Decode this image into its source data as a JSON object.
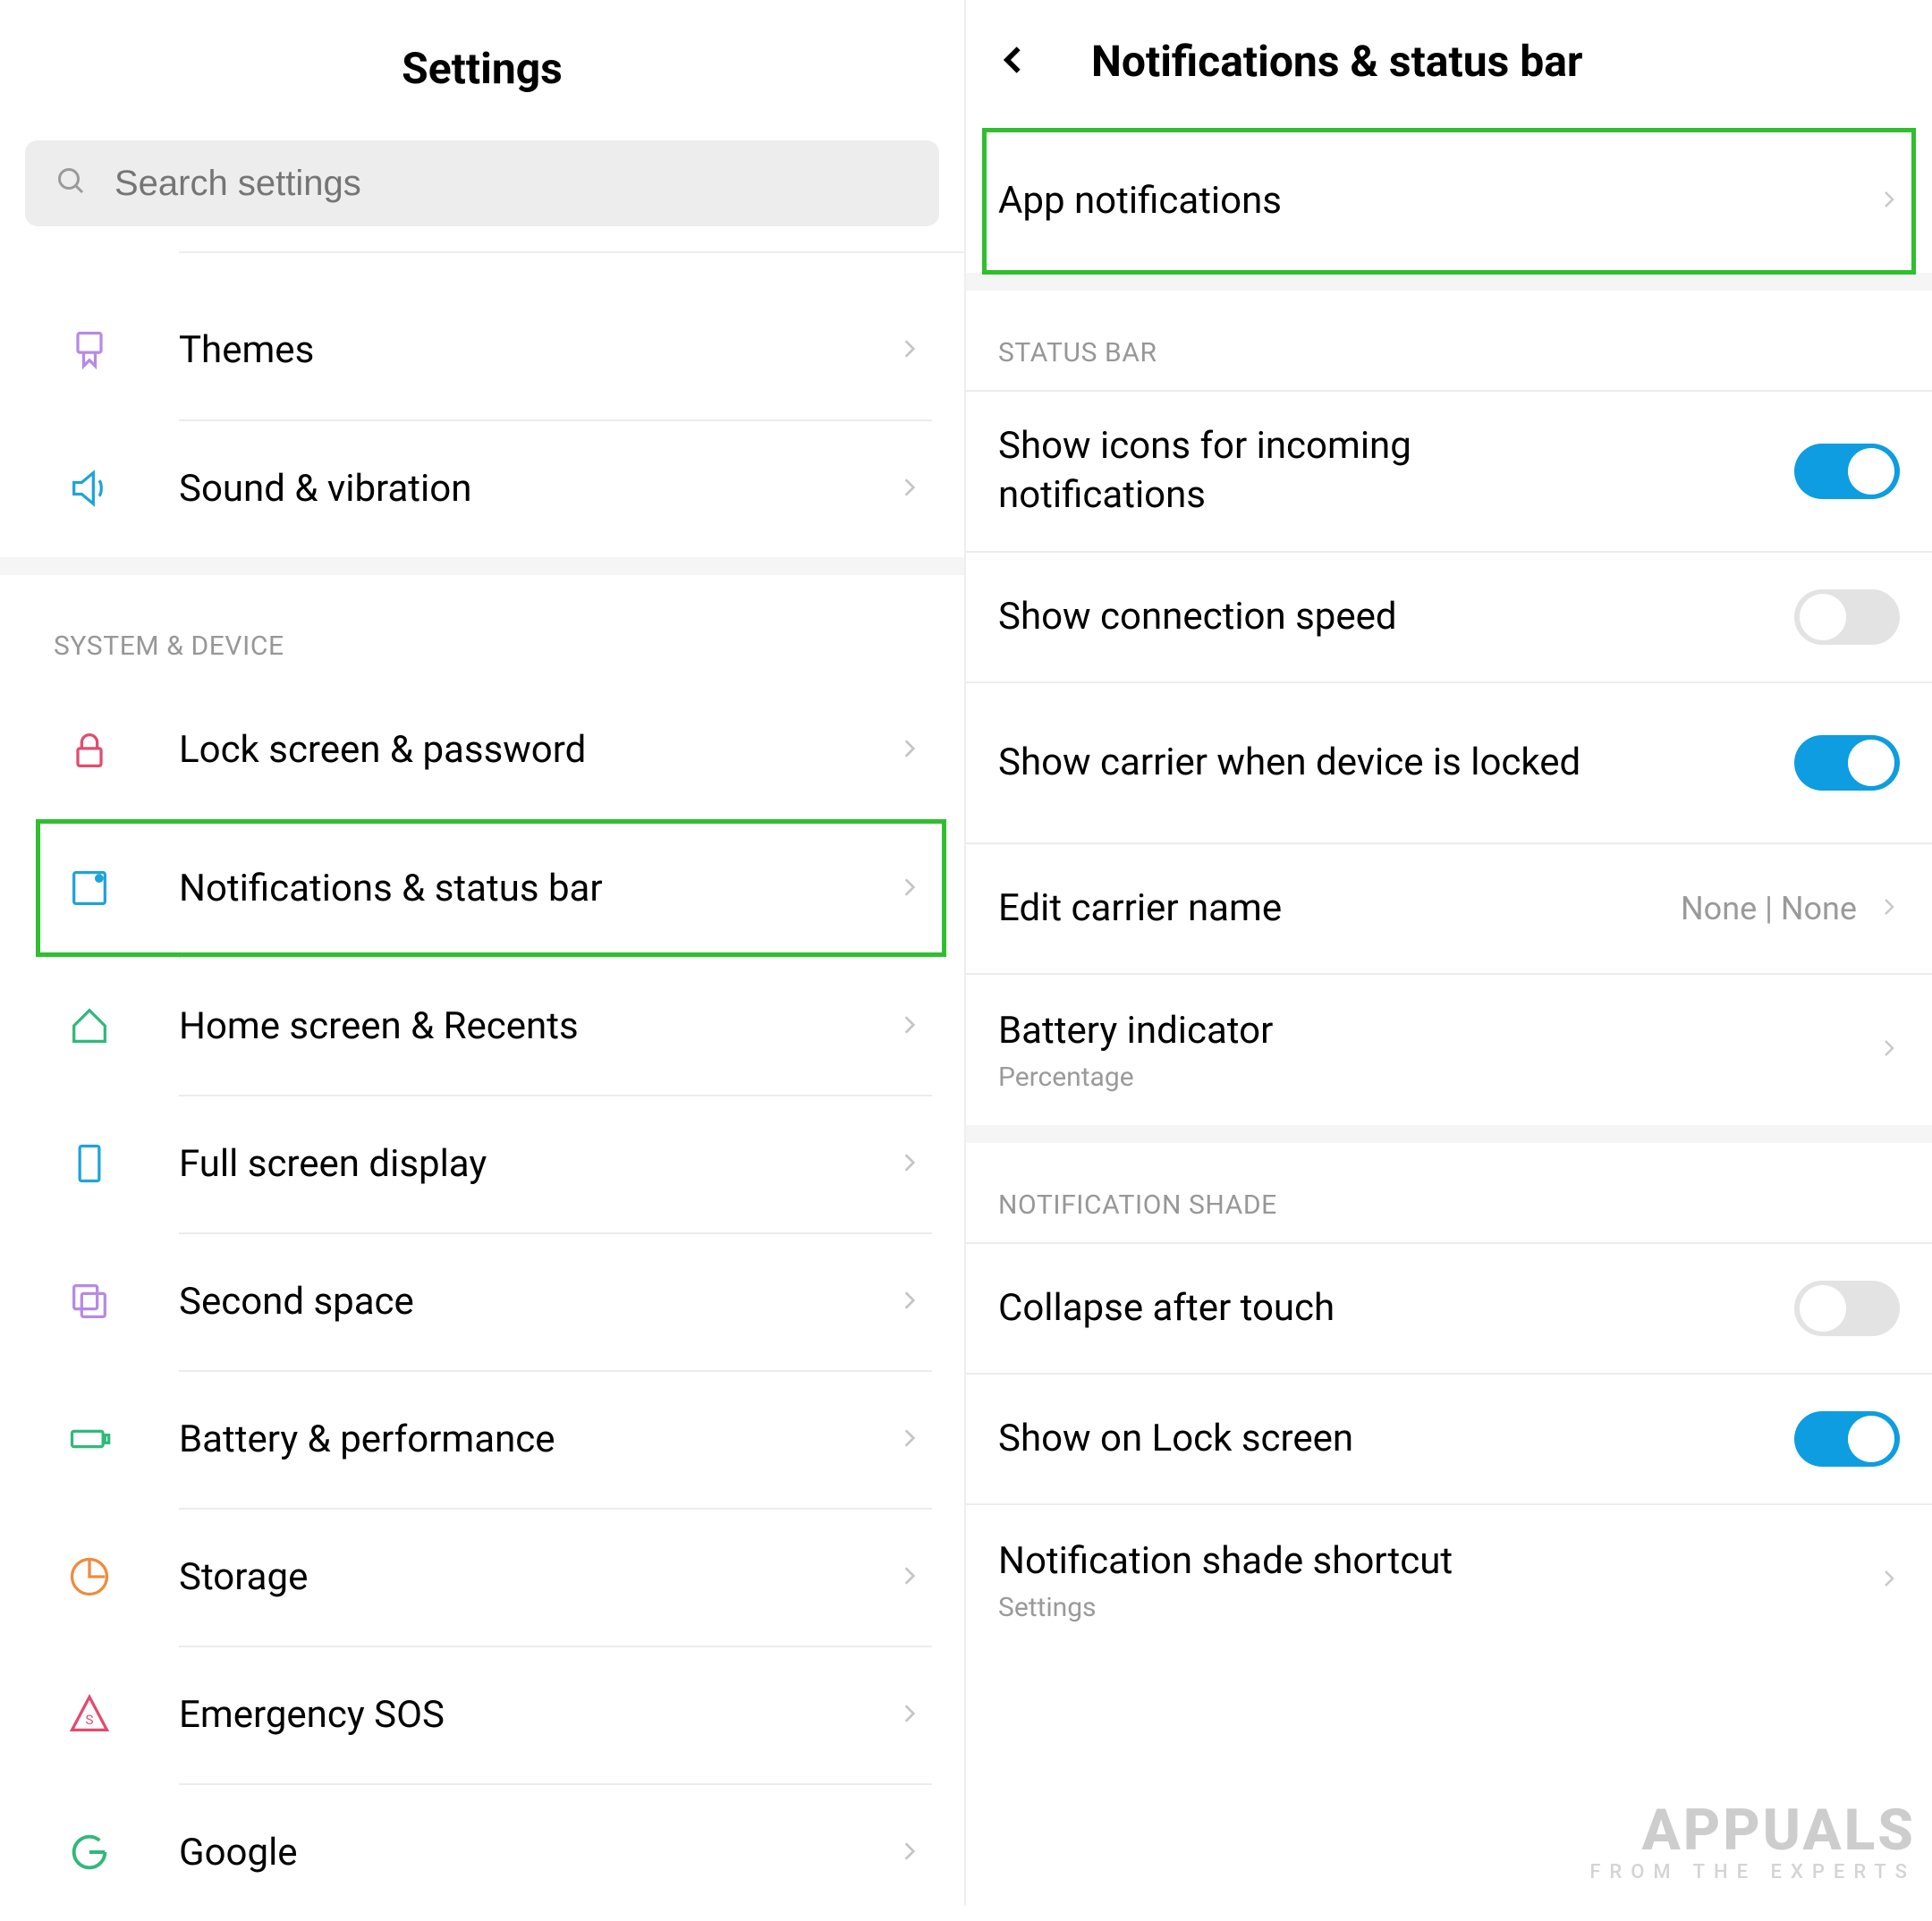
{
  "left": {
    "title": "Settings",
    "search_placeholder": "Search settings",
    "section1": "SYSTEM & DEVICE",
    "rows_top": [
      {
        "label": "Themes"
      },
      {
        "label": "Sound & vibration"
      }
    ],
    "rows_system": [
      {
        "label": "Lock screen & password"
      },
      {
        "label": "Notifications & status bar"
      },
      {
        "label": "Home screen & Recents"
      },
      {
        "label": "Full screen display"
      },
      {
        "label": "Second space"
      },
      {
        "label": "Battery & performance"
      },
      {
        "label": "Storage"
      },
      {
        "label": "Emergency SOS"
      },
      {
        "label": "Google"
      }
    ]
  },
  "right": {
    "title": "Notifications & status bar",
    "app_notifications": "App notifications",
    "section_status": "STATUS BAR",
    "status_rows": {
      "show_icons": "Show icons for incoming notifications",
      "show_speed": "Show connection speed",
      "show_carrier": "Show carrier when device is locked",
      "edit_carrier": "Edit carrier name",
      "edit_carrier_value": "None | None",
      "battery": "Battery indicator",
      "battery_sub": "Percentage"
    },
    "section_shade": "NOTIFICATION SHADE",
    "shade_rows": {
      "collapse": "Collapse after touch",
      "show_lock": "Show on Lock screen",
      "shortcut": "Notification shade shortcut",
      "shortcut_sub": "Settings"
    }
  },
  "watermark": {
    "main": "APPUALS",
    "sub": "FROM THE EXPERTS"
  },
  "colors": {
    "highlight": "#2fbf2f",
    "toggle_on": "#0d9de0",
    "toggle_off": "#e3e3e3"
  }
}
